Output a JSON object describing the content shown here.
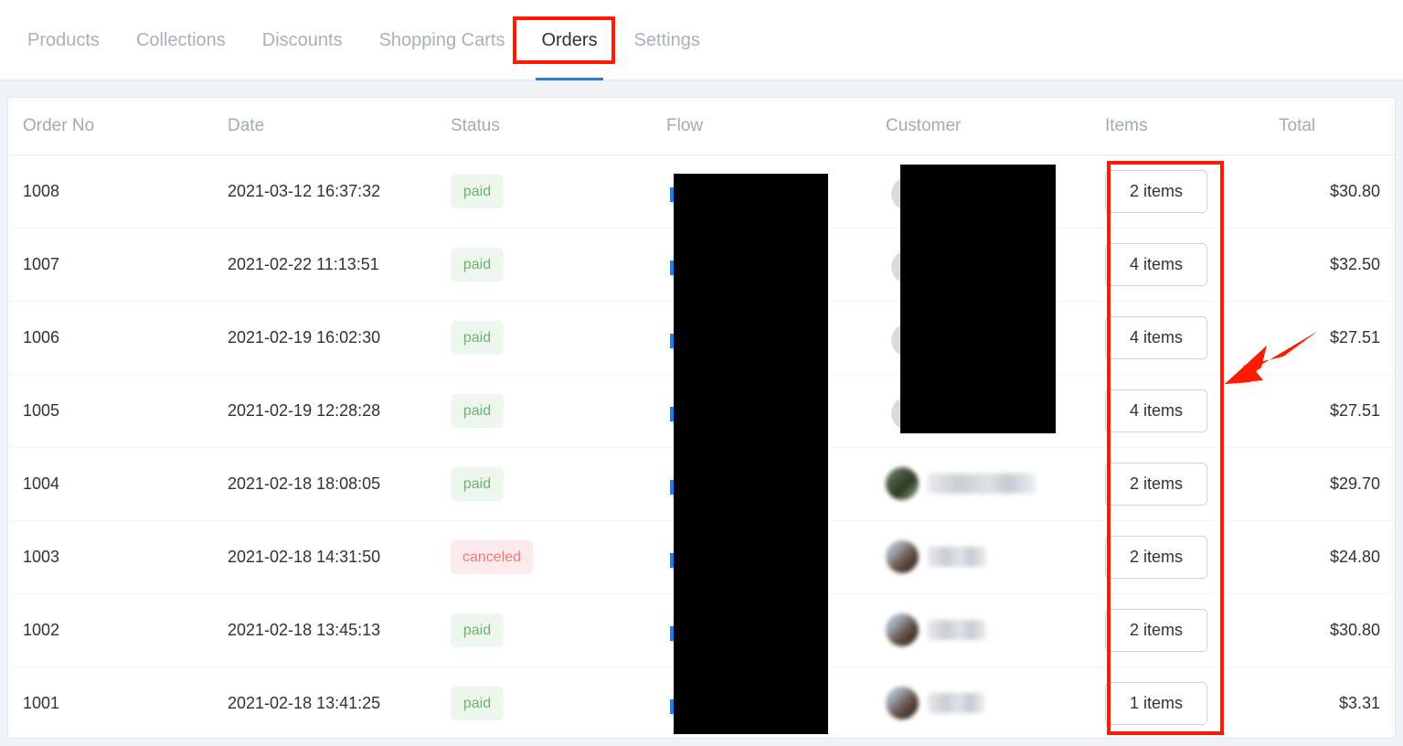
{
  "tabs": [
    {
      "label": "Products",
      "active": false
    },
    {
      "label": "Collections",
      "active": false
    },
    {
      "label": "Discounts",
      "active": false
    },
    {
      "label": "Shopping Carts",
      "active": false
    },
    {
      "label": "Orders",
      "active": true
    },
    {
      "label": "Settings",
      "active": false
    }
  ],
  "table": {
    "columns": [
      {
        "key": "order_no",
        "label": "Order No"
      },
      {
        "key": "date",
        "label": "Date"
      },
      {
        "key": "status",
        "label": "Status"
      },
      {
        "key": "flow",
        "label": "Flow"
      },
      {
        "key": "customer",
        "label": "Customer"
      },
      {
        "key": "items",
        "label": "Items"
      },
      {
        "key": "total",
        "label": "Total"
      }
    ],
    "rows": [
      {
        "order_no": "1008",
        "date": "2021-03-12 16:37:32",
        "status": "paid",
        "items": "2 items",
        "total": "$30.80",
        "customer_redacted": true,
        "flow_redacted": true
      },
      {
        "order_no": "1007",
        "date": "2021-02-22 11:13:51",
        "status": "paid",
        "items": "4 items",
        "total": "$32.50",
        "customer_redacted": true,
        "flow_redacted": true
      },
      {
        "order_no": "1006",
        "date": "2021-02-19 16:02:30",
        "status": "paid",
        "items": "4 items",
        "total": "$27.51",
        "customer_redacted": true,
        "flow_redacted": true
      },
      {
        "order_no": "1005",
        "date": "2021-02-19 12:28:28",
        "status": "paid",
        "items": "4 items",
        "total": "$27.51",
        "customer_redacted": true,
        "flow_redacted": true
      },
      {
        "order_no": "1004",
        "date": "2021-02-18 18:08:05",
        "status": "paid",
        "items": "2 items",
        "total": "$29.70",
        "customer_redacted": false,
        "flow_redacted": true
      },
      {
        "order_no": "1003",
        "date": "2021-02-18 14:31:50",
        "status": "canceled",
        "items": "2 items",
        "total": "$24.80",
        "customer_redacted": false,
        "flow_redacted": true
      },
      {
        "order_no": "1002",
        "date": "2021-02-18 13:45:13",
        "status": "paid",
        "items": "2 items",
        "total": "$30.80",
        "customer_redacted": false,
        "flow_redacted": true
      },
      {
        "order_no": "1001",
        "date": "2021-02-18 13:41:25",
        "status": "paid",
        "items": "1 items",
        "total": "$3.31",
        "customer_redacted": false,
        "flow_redacted": true
      }
    ]
  },
  "annotations": {
    "color": "#fe1b00",
    "highlight_tab": "Orders",
    "highlight_column": "Items",
    "arrow": "arrow-pointing-down-left"
  },
  "colors": {
    "accent_tab_underline": "#1a7ff0",
    "paid_badge_bg": "#eef7ee",
    "paid_badge_text": "#6cb36f",
    "canceled_badge_bg": "#fdeaea",
    "canceled_badge_text": "#f2777a",
    "page_bg": "#eef1f5",
    "card_bg": "#ffffff",
    "header_text": "#a3aab6"
  }
}
